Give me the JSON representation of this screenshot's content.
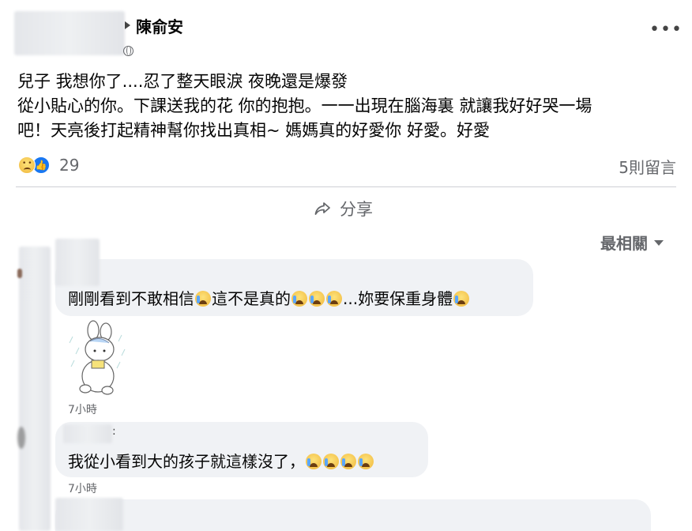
{
  "post": {
    "group_name": "陳俞安",
    "lines": [
      "兒子 我想你了....忍了整天眼淚  夜晚還是爆發",
      "從小貼心的你。下課送我的花 你的抱抱。一一出現在腦海裏 就讓我好好哭一場",
      "吧！天亮後打起精神幫你找出真相~ 媽媽真的好愛你 好愛。好愛"
    ],
    "reaction_count": "29",
    "comment_count": "5則留言",
    "share_label": "分享",
    "reactions": [
      "sad-icon",
      "like-icon"
    ]
  },
  "comments": {
    "sort_label": "最相關",
    "items": [
      {
        "text_a": "剛剛看到不敢相信",
        "text_b": "這不是真的",
        "text_c": "...妳要保重身體",
        "time": "7小時",
        "has_sticker": true
      },
      {
        "text": "我從小看到大的孩子就這樣沒了，",
        "time": "7小時"
      }
    ]
  },
  "colors": {
    "secondary_text": "#65676b",
    "bubble": "#f0f2f5",
    "like_blue": "#1877f2"
  }
}
